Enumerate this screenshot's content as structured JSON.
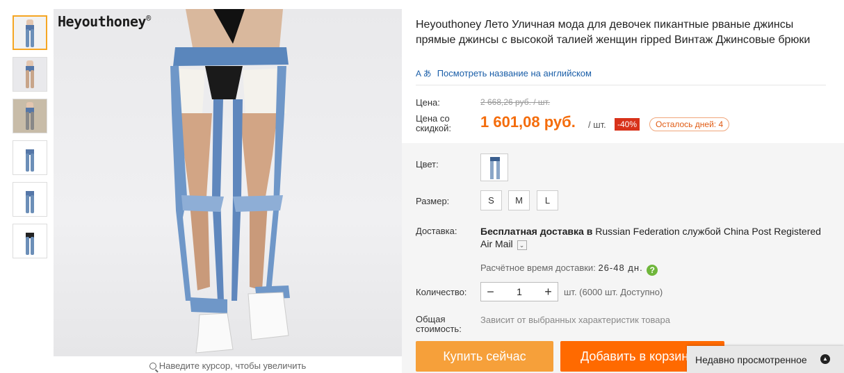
{
  "gallery": {
    "brand": "Heyouthoney",
    "brand_mark": "®",
    "zoom_hint": "Наведите курсор, чтобы увеличить",
    "thumbnails": [
      "thumb-1",
      "thumb-2",
      "thumb-3",
      "thumb-4",
      "thumb-5",
      "thumb-6"
    ]
  },
  "product": {
    "title": "Heyouthoney Лето Уличная мода для девочек пикантные рваные джинсы прямые джинсы с высокой талией женщин ripped Винтаж Джинсовые брюки",
    "translate_link": "Посмотреть название на английском",
    "translate_icon": "A あ"
  },
  "price": {
    "label": "Цена:",
    "old": "2 668,26 руб. / шт.",
    "discount_label": "Цена со скидкой:",
    "new": "1 601,08 руб.",
    "per_unit": "/ шт.",
    "discount_badge": "-40%",
    "days_left": "Осталось дней: 4",
    "accent_color": "#f46c0b"
  },
  "options": {
    "color_label": "Цвет:",
    "size_label": "Размер:",
    "sizes": [
      "S",
      "M",
      "L"
    ],
    "delivery_label": "Доставка:",
    "delivery_bold": "Бесплатная доставка в",
    "delivery_rest": " Russian Federation службой China Post Registered Air Mail",
    "delivery_time_label": "Расчётное время доставки:",
    "delivery_time_value": "26-48 дн.",
    "help_icon": "?",
    "quantity_label": "Количество:",
    "quantity_value": "1",
    "quantity_minus": "−",
    "quantity_plus": "+",
    "quantity_note": "шт. (6000 шт. Доступно)",
    "total_label": "Общая стоимость:",
    "total_note": "Зависит от выбранных характеристик товара"
  },
  "actions": {
    "buy_now": "Купить сейчас",
    "add_to_cart": "Добавить в корзину"
  },
  "recent": {
    "label": "Недавно просмотренное"
  }
}
